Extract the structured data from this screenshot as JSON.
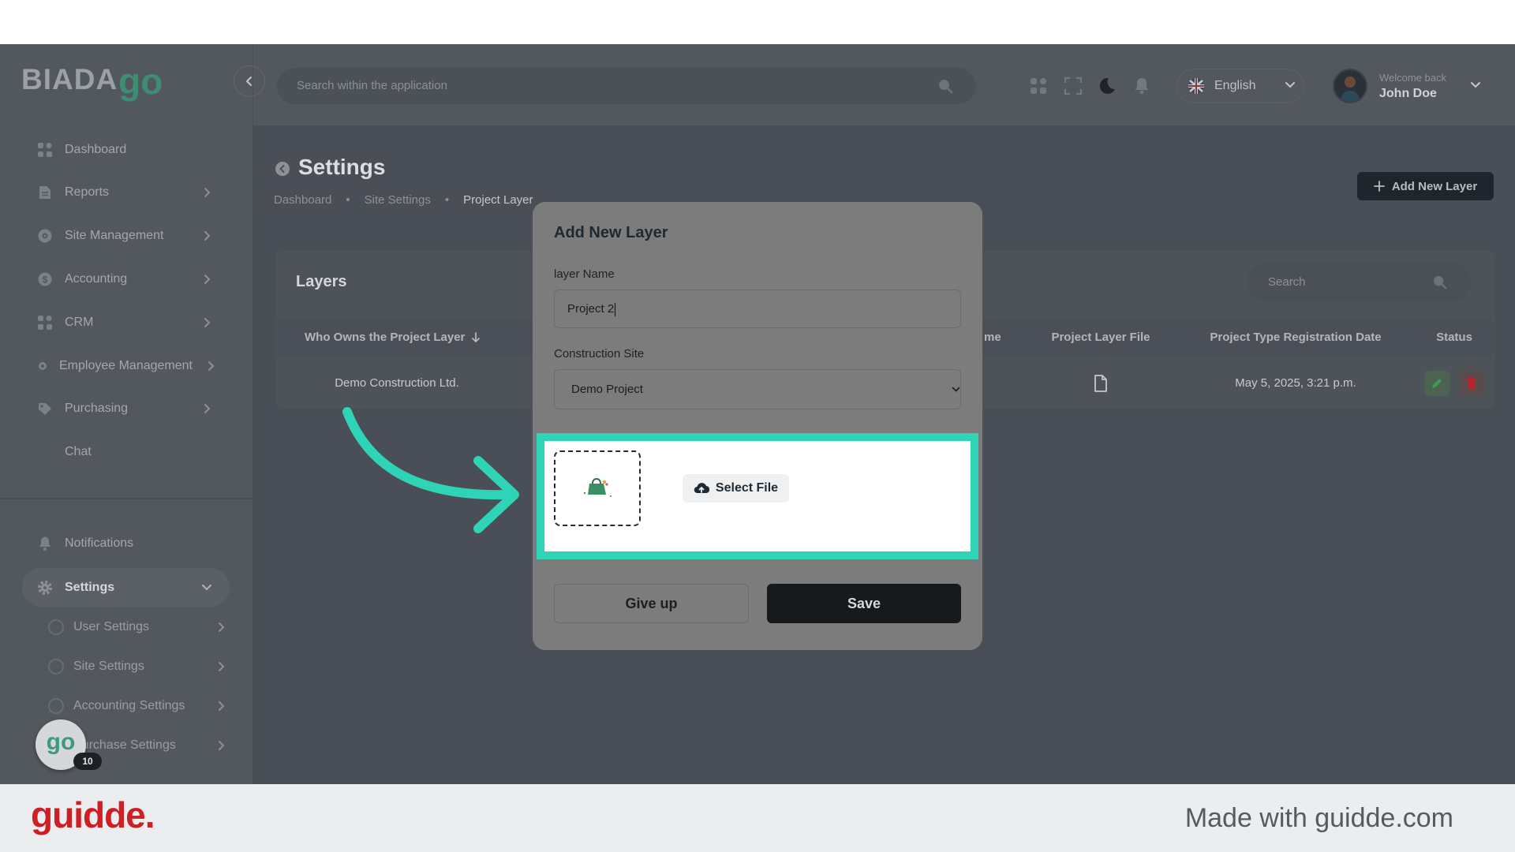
{
  "logo": {
    "text_main": "BIADA",
    "text_accent": "go"
  },
  "header": {
    "search_placeholder": "Search within the application",
    "language": "English",
    "welcome": "Welcome back",
    "user_name": "John Doe",
    "icons": [
      "apps-icon",
      "fullscreen-icon",
      "moon-icon",
      "bell-icon"
    ]
  },
  "sidebar": {
    "items": [
      {
        "label": "Dashboard",
        "icon": "dashboard-icon"
      },
      {
        "label": "Reports",
        "icon": "reports-icon"
      },
      {
        "label": "Site Management",
        "icon": "site-management-icon"
      },
      {
        "label": "Accounting",
        "icon": "accounting-icon"
      },
      {
        "label": "CRM",
        "icon": "crm-icon"
      },
      {
        "label": "Employee Management",
        "icon": "employee-icon"
      },
      {
        "label": "Purchasing",
        "icon": "purchasing-icon"
      },
      {
        "label": "Chat",
        "icon": ""
      }
    ],
    "notifications": "Notifications",
    "settings": "Settings",
    "settings_subitems": [
      "User Settings",
      "Site Settings",
      "Accounting Settings",
      "Purchase Settings"
    ]
  },
  "page": {
    "title": "Settings",
    "breadcrumb": [
      "Dashboard",
      "Site Settings",
      "Project Layer"
    ],
    "add_button": "Add New Layer"
  },
  "card": {
    "title": "Layers",
    "search_placeholder": "Search",
    "columns": [
      "Who Owns the Project Layer",
      "me",
      "Project Layer File",
      "Project Type Registration Date",
      "Status"
    ],
    "rows": [
      {
        "owner": "Demo Construction Ltd.",
        "registration_date": "May 5, 2025, 3:21 p.m."
      }
    ]
  },
  "modal": {
    "title": "Add New Layer",
    "layer_name_label": "layer Name",
    "layer_name_value": "Project 2",
    "construction_site_label": "Construction Site",
    "construction_site_value": "Demo Project",
    "select_file": "Select File",
    "give_up": "Give up",
    "save": "Save"
  },
  "guidde": {
    "bubble_logo": "go",
    "badge": "10",
    "brand": "guidde.",
    "made_with": "Made with guidde.com"
  },
  "colors": {
    "highlight": "#2fd3b5",
    "guidde_red": "#cf1f25",
    "logo_green": "#3f8c74",
    "save_button": "#171a1d"
  }
}
